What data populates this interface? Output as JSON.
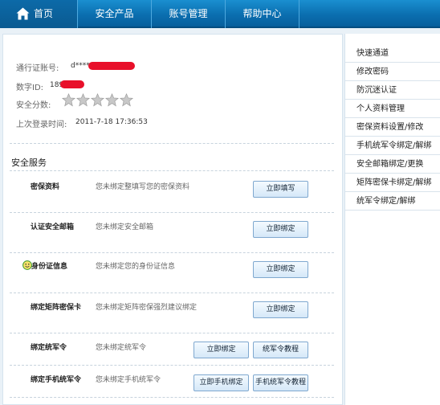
{
  "nav": {
    "home": "首页",
    "items": [
      "安全产品",
      "账号管理",
      "帮助中心"
    ]
  },
  "account": {
    "passport_label": "通行证账号:",
    "passport_value": "d****",
    "digital_id_label": "数字ID:",
    "digital_id_value": "189",
    "score_label": "安全分数:",
    "score_stars": 0,
    "score_max": 5,
    "last_login_label": "上次登录时间:",
    "last_login_value": "2011-7-18 17:36:53"
  },
  "services": {
    "title": "安全服务",
    "rows": [
      {
        "name": "密保资料",
        "desc": "您未绑定整填写您的密保资料",
        "buttons": [
          "立即填写"
        ]
      },
      {
        "name": "认证安全邮箱",
        "desc": "您未绑定安全邮箱",
        "buttons": [
          "立即绑定"
        ]
      },
      {
        "name": "身份证信息",
        "desc": "您未绑定您的身份证信息",
        "buttons": [
          "立即绑定"
        ]
      },
      {
        "name": "绑定矩阵密保卡",
        "desc": "您未绑定矩阵密保强烈建议绑定",
        "buttons": [
          "立即绑定"
        ]
      },
      {
        "name": "绑定统军令",
        "desc": "您未绑定统军令",
        "buttons": [
          "立即绑定",
          "统军令教程"
        ]
      },
      {
        "name": "绑定手机统军令",
        "desc": "您未绑定手机统军令",
        "buttons": [
          "立即手机绑定",
          "手机统军令教程"
        ]
      }
    ]
  },
  "sidebar": {
    "items": [
      "快速通道",
      "修改密码",
      "防沉迷认证",
      "个人资料管理",
      "密保资料设置/修改",
      "手机统军令绑定/解绑",
      "安全邮箱绑定/更换",
      "矩阵密保卡绑定/解绑",
      "统军令绑定/解绑"
    ]
  },
  "colors": {
    "nav_bg": "#0b6fb0",
    "redaction": "#e8102a",
    "star": "#c4c4c4"
  }
}
